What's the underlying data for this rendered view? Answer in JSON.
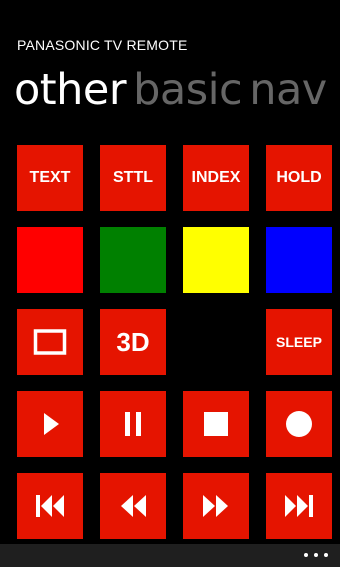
{
  "app": {
    "title": "PANASONIC TV REMOTE"
  },
  "pivot": {
    "tabs": [
      "other",
      "basic",
      "nav"
    ],
    "active_index": 0
  },
  "tiles": {
    "text": "TEXT",
    "sttl": "STTL",
    "index": "INDEX",
    "hold": "HOLD",
    "aspect_3d": "3D",
    "sleep": "SLEEP"
  },
  "color_keys": {
    "red": "#ff0000",
    "green": "#008000",
    "yellow": "#ffff00",
    "blue": "#0000ff"
  },
  "icons": {
    "aspect": "aspect-ratio-icon",
    "play": "play-icon",
    "pause": "pause-icon",
    "stop": "stop-icon",
    "record": "record-icon",
    "skip_previous": "skip-previous-icon",
    "rewind": "rewind-icon",
    "fast_forward": "fast-forward-icon",
    "skip_next": "skip-next-icon",
    "more": "more-icon"
  },
  "colors": {
    "tile_accent": "#e51400",
    "background": "#000000",
    "inactive_pivot": "#666666",
    "appbar": "#1f1f1f"
  }
}
